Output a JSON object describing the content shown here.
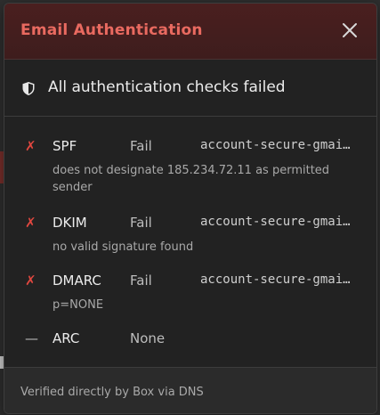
{
  "dialog": {
    "title": "Email Authentication",
    "close_icon": "close-icon",
    "summary": {
      "icon": "shield-icon",
      "text": "All authentication checks failed"
    },
    "checks": [
      {
        "mark": "✗",
        "status": "fail",
        "protocol": "SPF",
        "result": "Fail",
        "domain": "account-secure-gmail-login.com",
        "detail": "does not designate 185.234.72.11 as permitted sender"
      },
      {
        "mark": "✗",
        "status": "fail",
        "protocol": "DKIM",
        "result": "Fail",
        "domain": "account-secure-gmail-login.com",
        "detail": "no valid signature found"
      },
      {
        "mark": "✗",
        "status": "fail",
        "protocol": "DMARC",
        "result": "Fail",
        "domain": "account-secure-gmail-login.com",
        "detail": "p=NONE"
      },
      {
        "mark": "—",
        "status": "none",
        "protocol": "ARC",
        "result": "None",
        "domain": "",
        "detail": ""
      }
    ],
    "footer": "Verified directly by Box via DNS"
  },
  "colors": {
    "header_bg": "#4a1f1f",
    "title": "#e96a60",
    "fail_mark": "#e0473f",
    "dialog_bg": "#222222",
    "footer_bg": "#2b2b2b"
  }
}
